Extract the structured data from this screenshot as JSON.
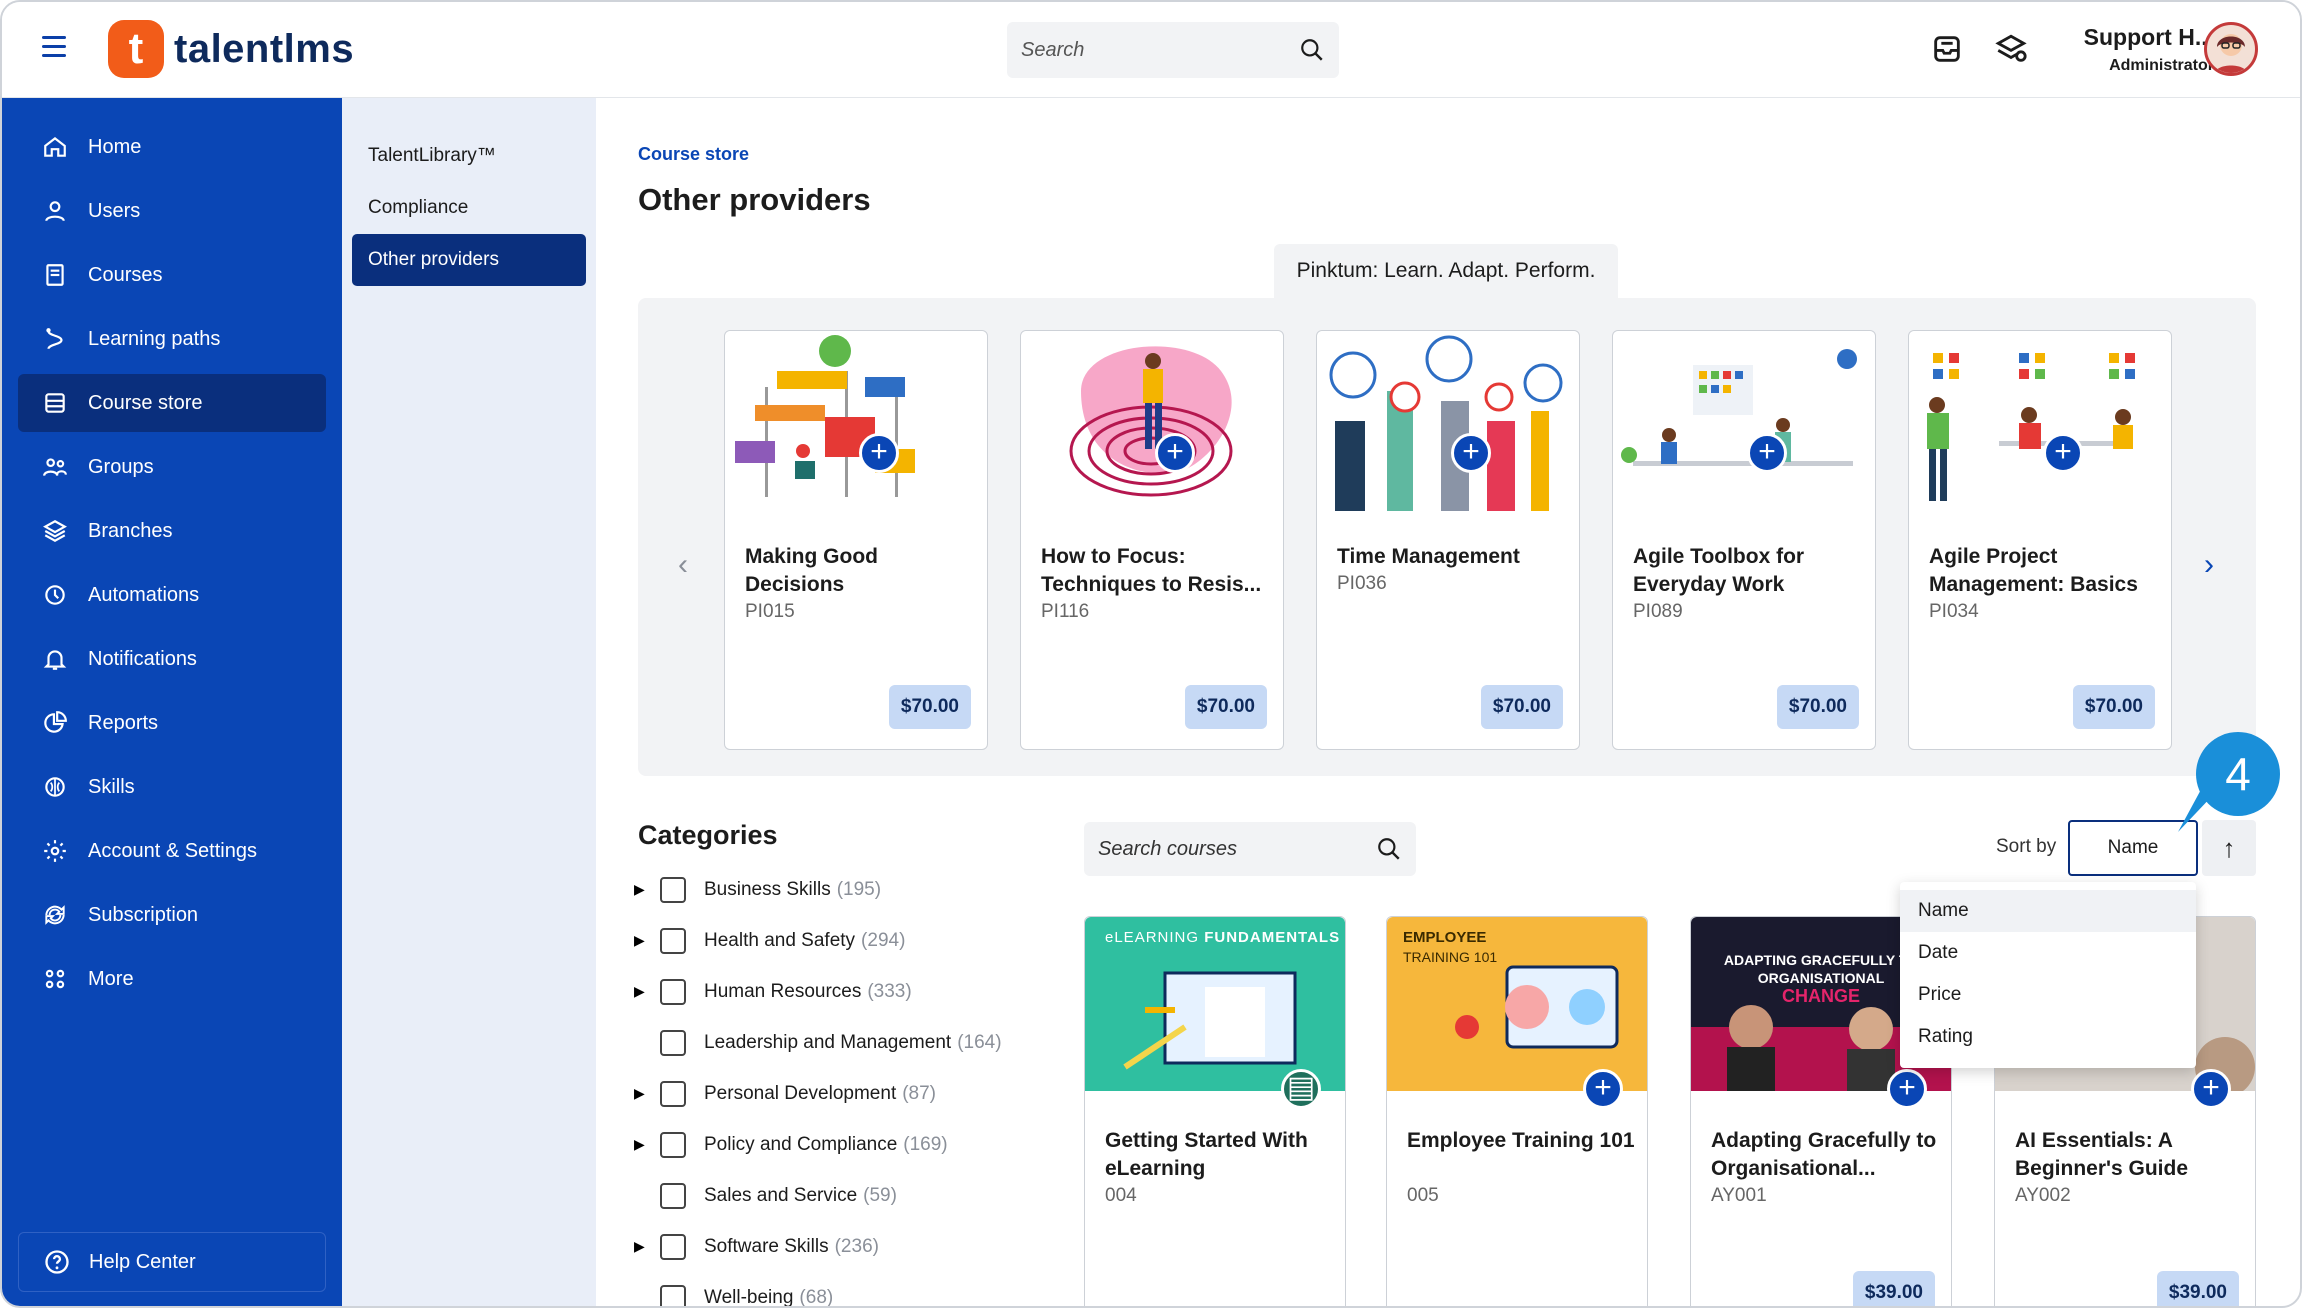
{
  "app": {
    "logo_letter": "t",
    "logo_text": "talentlms"
  },
  "header": {
    "search_placeholder": "Search",
    "user_name": "Support H...",
    "user_role": "Administrator"
  },
  "sidebar": {
    "items": [
      {
        "label": "Home",
        "icon": "home-icon"
      },
      {
        "label": "Users",
        "icon": "user-icon"
      },
      {
        "label": "Courses",
        "icon": "book-icon"
      },
      {
        "label": "Learning paths",
        "icon": "path-icon"
      },
      {
        "label": "Course store",
        "icon": "store-icon",
        "active": true
      },
      {
        "label": "Groups",
        "icon": "groups-icon"
      },
      {
        "label": "Branches",
        "icon": "layers-icon"
      },
      {
        "label": "Automations",
        "icon": "automation-icon"
      },
      {
        "label": "Notifications",
        "icon": "bell-icon"
      },
      {
        "label": "Reports",
        "icon": "pie-chart-icon"
      },
      {
        "label": "Skills",
        "icon": "brain-icon"
      },
      {
        "label": "Account & Settings",
        "icon": "gear-icon"
      },
      {
        "label": "Subscription",
        "icon": "refresh-icon"
      },
      {
        "label": "More",
        "icon": "grid-icon"
      }
    ],
    "help_label": "Help Center"
  },
  "subnav": {
    "items": [
      {
        "label": "TalentLibrary™"
      },
      {
        "label": "Compliance"
      },
      {
        "label": "Other providers",
        "active": true
      }
    ]
  },
  "main": {
    "breadcrumb": "Course store",
    "title": "Other providers",
    "provider_tab": "Pinktum: Learn. Adapt. Perform.",
    "featured": [
      {
        "title": "Making Good Decisions",
        "code": "PI015",
        "price": "$70.00"
      },
      {
        "title": "How to Focus: Techniques to Resis...",
        "code": "PI116",
        "price": "$70.00"
      },
      {
        "title": "Time Management",
        "code": "PI036",
        "price": "$70.00"
      },
      {
        "title": "Agile Toolbox for Everyday Work",
        "code": "PI089",
        "price": "$70.00"
      },
      {
        "title": "Agile Project Management: Basics",
        "code": "PI034",
        "price": "$70.00"
      }
    ],
    "categories_title": "Categories",
    "categories": [
      {
        "label": "Business Skills",
        "count": "(195)",
        "expandable": true
      },
      {
        "label": "Health and Safety",
        "count": "(294)",
        "expandable": true
      },
      {
        "label": "Human Resources",
        "count": "(333)",
        "expandable": true
      },
      {
        "label": "Leadership and Management",
        "count": "(164)",
        "expandable": false
      },
      {
        "label": "Personal Development",
        "count": "(87)",
        "expandable": true
      },
      {
        "label": "Policy and Compliance",
        "count": "(169)",
        "expandable": true
      },
      {
        "label": "Sales and Service",
        "count": "(59)",
        "expandable": false
      },
      {
        "label": "Software Skills",
        "count": "(236)",
        "expandable": true
      },
      {
        "label": "Well-being",
        "count": "(68)",
        "expandable": false
      }
    ],
    "course_search_placeholder": "Search courses",
    "sort_label": "Sort by",
    "sort_value": "Name",
    "sort_direction": "↑",
    "sort_options": [
      "Name",
      "Date",
      "Price",
      "Rating"
    ],
    "step_number": "4",
    "courses": [
      {
        "title": "Getting Started With eLearning",
        "code": "004",
        "banner_a": "eLEARNING",
        "banner_b": "FUNDAMENTALS"
      },
      {
        "title": "Employee Training 101",
        "code": "005",
        "banner_a": "EMPLOYEE",
        "banner_b": "TRAINING 101"
      },
      {
        "title": "Adapting Gracefully to Organisational...",
        "code": "AY001",
        "price": "$39.00",
        "banner_a": "ADAPTING GRACEFULLY TO",
        "banner_b": "ORGANISATIONAL",
        "banner_c": "CHANGE"
      },
      {
        "title": "AI Essentials: A Beginner's Guide",
        "code": "AY002",
        "price": "$39.00"
      }
    ]
  },
  "colors": {
    "brand_blue": "#0a46b5",
    "dark_blue": "#0a2f7d",
    "logo_orange": "#f25c19",
    "price_bg": "#c6d9f5",
    "step_badge": "#1a8fd9"
  }
}
